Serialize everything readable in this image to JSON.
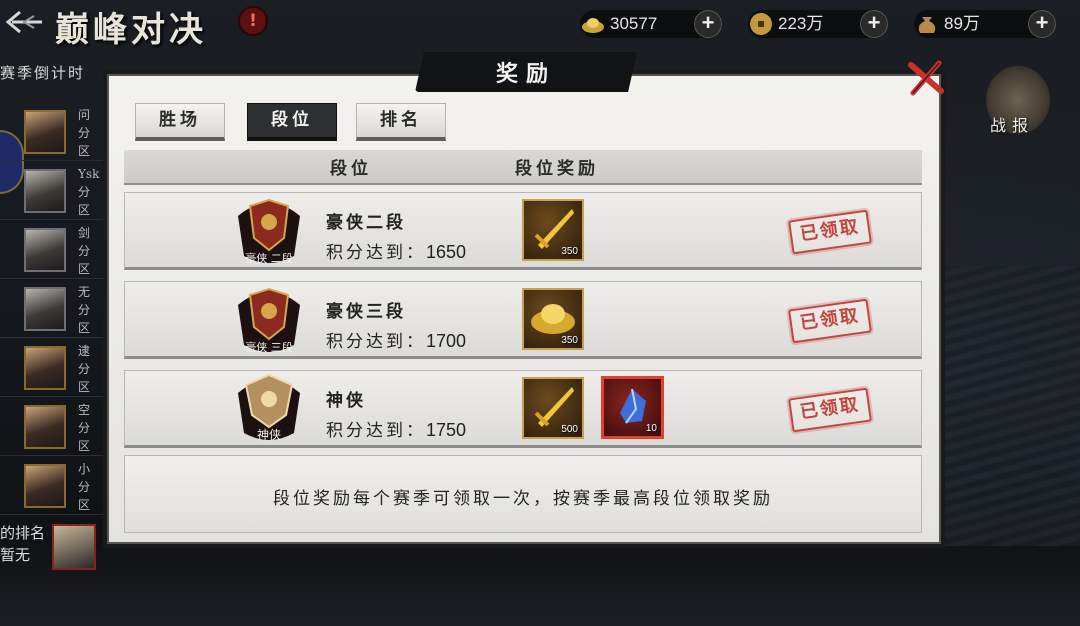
{
  "header": {
    "title": "巅峰对决",
    "alert": "!"
  },
  "currencies": [
    {
      "icon": "gold-ingot-icon",
      "value": "30577"
    },
    {
      "icon": "copper-coin-icon",
      "value": "223万"
    },
    {
      "icon": "money-bag-icon",
      "value": "89万"
    }
  ],
  "season": {
    "countdown_label": "赛季倒计时",
    "countdown_value": ""
  },
  "left_list": {
    "items": [
      {
        "l1": "问",
        "l2": "分",
        "l3": "区"
      },
      {
        "l1": "Ysk",
        "l2": "分",
        "l3": "区"
      },
      {
        "l1": "剑",
        "l2": "分",
        "l3": "区"
      },
      {
        "l1": "无",
        "l2": "分",
        "l3": "区"
      },
      {
        "l1": "逮",
        "l2": "分",
        "l3": "区"
      },
      {
        "l1": "空",
        "l2": "分",
        "l3": "区"
      },
      {
        "l1": "小",
        "l2": "分",
        "l3": "区"
      }
    ],
    "my_rank_label": "的排名",
    "my_rank_value": "暂无"
  },
  "battle_report": {
    "label": "战报"
  },
  "dialog": {
    "title": "奖励",
    "tabs": [
      {
        "label": "胜场",
        "active": false
      },
      {
        "label": "段位",
        "active": true
      },
      {
        "label": "排名",
        "active": false
      }
    ],
    "columns": {
      "rank": "段位",
      "reward": "段位奖励"
    },
    "rows": [
      {
        "emblem_text": "豪侠 二段",
        "name": "豪侠二段",
        "req_label": "积分达到：",
        "req_value": "1650",
        "rewards": [
          {
            "icon": "golden-sword-icon",
            "count": "350",
            "rarity": "gold"
          }
        ],
        "status": "已领取"
      },
      {
        "emblem_text": "豪侠 三段",
        "name": "豪侠三段",
        "req_label": "积分达到：",
        "req_value": "1700",
        "rewards": [
          {
            "icon": "gold-ingot-icon",
            "count": "350",
            "rarity": "gold"
          }
        ],
        "status": "已领取"
      },
      {
        "emblem_text": "神侠",
        "name": "神侠",
        "req_label": "积分达到：",
        "req_value": "1750",
        "rewards": [
          {
            "icon": "golden-sword-icon",
            "count": "500",
            "rarity": "gold"
          },
          {
            "icon": "blue-crystal-icon",
            "count": "10",
            "rarity": "red"
          }
        ],
        "status": "已领取"
      }
    ],
    "note": "段位奖励每个赛季可领取一次，按赛季最高段位领取奖励"
  },
  "colors": {
    "accent_red": "#c2453e",
    "gold_border": "#c7a052",
    "dark_tab": "#2d2f31"
  }
}
